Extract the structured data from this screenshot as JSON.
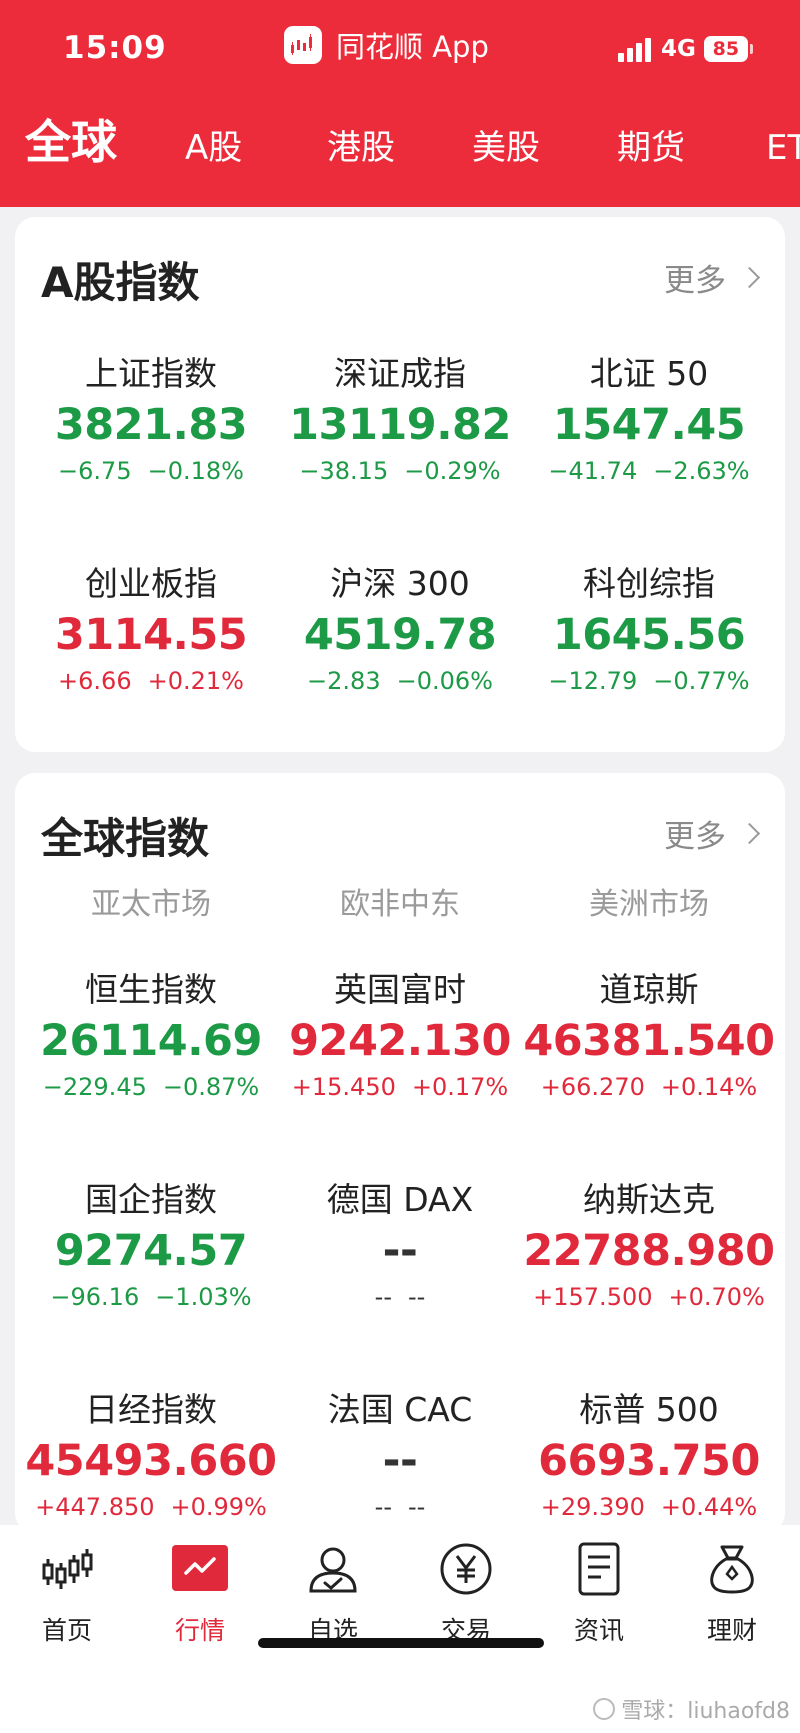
{
  "status": {
    "time": "15:09",
    "app_name": "同花顺 App",
    "network": "4G",
    "battery": "85"
  },
  "tabs": [
    "全球",
    "A股",
    "港股",
    "美股",
    "期货",
    "ET"
  ],
  "a_share": {
    "title": "A股指数",
    "more": "更多",
    "items": [
      {
        "name": "上证指数",
        "value": "3821.83",
        "change": "−6.75",
        "pct": "−0.18%",
        "dir": "down"
      },
      {
        "name": "深证成指",
        "value": "13119.82",
        "change": "−38.15",
        "pct": "−0.29%",
        "dir": "down"
      },
      {
        "name": "北证 50",
        "value": "1547.45",
        "change": "−41.74",
        "pct": "−2.63%",
        "dir": "down"
      },
      {
        "name": "创业板指",
        "value": "3114.55",
        "change": "+6.66",
        "pct": "+0.21%",
        "dir": "up"
      },
      {
        "name": "沪深 300",
        "value": "4519.78",
        "change": "−2.83",
        "pct": "−0.06%",
        "dir": "down"
      },
      {
        "name": "科创综指",
        "value": "1645.56",
        "change": "−12.79",
        "pct": "−0.77%",
        "dir": "down"
      }
    ]
  },
  "global": {
    "title": "全球指数",
    "more": "更多",
    "regions": [
      "亚太市场",
      "欧非中东",
      "美洲市场"
    ],
    "items": [
      {
        "name": "恒生指数",
        "value": "26114.69",
        "change": "−229.45",
        "pct": "−0.87%",
        "dir": "down"
      },
      {
        "name": "英国富时",
        "value": "9242.130",
        "change": "+15.450",
        "pct": "+0.17%",
        "dir": "up"
      },
      {
        "name": "道琼斯",
        "value": "46381.540",
        "change": "+66.270",
        "pct": "+0.14%",
        "dir": "up"
      },
      {
        "name": "国企指数",
        "value": "9274.57",
        "change": "−96.16",
        "pct": "−1.03%",
        "dir": "down"
      },
      {
        "name": "德国 DAX",
        "value": "--",
        "change": "--",
        "pct": "--",
        "dir": "flat"
      },
      {
        "name": "纳斯达克",
        "value": "22788.980",
        "change": "+157.500",
        "pct": "+0.70%",
        "dir": "up"
      },
      {
        "name": "日经指数",
        "value": "45493.660",
        "change": "+447.850",
        "pct": "+0.99%",
        "dir": "up"
      },
      {
        "name": "法国 CAC",
        "value": "--",
        "change": "--",
        "pct": "--",
        "dir": "flat"
      },
      {
        "name": "标普 500",
        "value": "6693.750",
        "change": "+29.390",
        "pct": "+0.44%",
        "dir": "up"
      }
    ]
  },
  "nav": [
    {
      "label": "首页",
      "icon": "candlestick-icon"
    },
    {
      "label": "行情",
      "icon": "market-trend-icon"
    },
    {
      "label": "自选",
      "icon": "watchlist-person-icon"
    },
    {
      "label": "交易",
      "icon": "yen-coin-icon"
    },
    {
      "label": "资讯",
      "icon": "news-document-icon"
    },
    {
      "label": "理财",
      "icon": "money-bag-icon"
    }
  ],
  "watermark": "雪球：liuhaofd8",
  "colors": {
    "brand_red": "#ec2c3b",
    "up": "#e0293b",
    "down": "#1c9a46"
  }
}
